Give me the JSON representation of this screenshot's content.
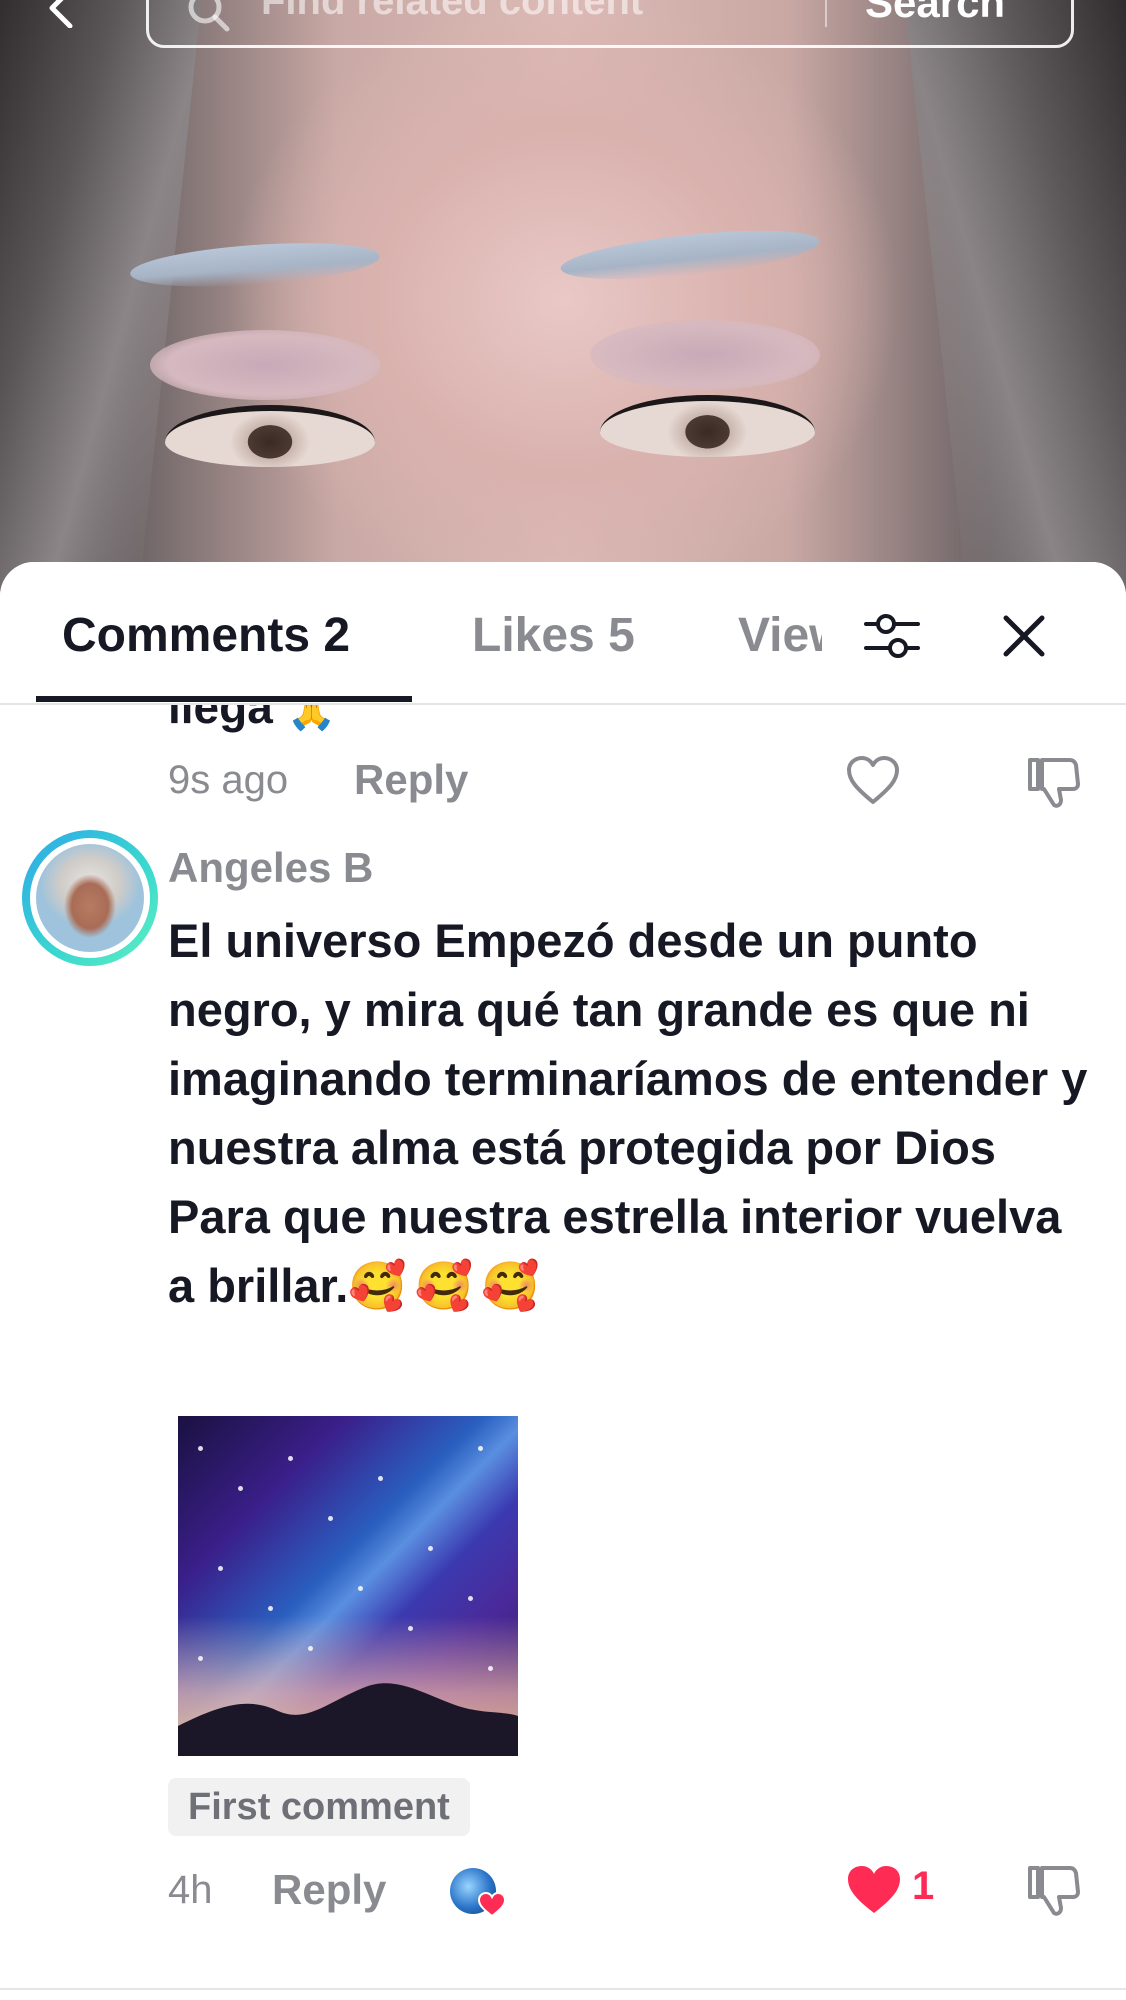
{
  "search": {
    "placeholder": "Find related content",
    "button": "Search"
  },
  "tabs": {
    "comments": "Comments 2",
    "likes": "Likes 5",
    "views": "Views"
  },
  "previous_comment": {
    "text_fragment": "llega",
    "emoji": "🙏",
    "time": "9s ago",
    "reply": "Reply"
  },
  "comment": {
    "author": "Angeles B",
    "text": "El universo Empezó desde un punto negro, y mira qué tan grande es que ni imaginando terminaríamos de entender y nuestra alma está protegida por Dios Para que nuestra estrella interior vuelva a brillar.",
    "emojis": "🥰🥰🥰",
    "badge": "First comment",
    "time": "4h",
    "reply": "Reply",
    "like_count": "1"
  },
  "colors": {
    "primary_text": "#161823",
    "secondary_text": "#8a8b91",
    "like_red": "#fe2c55"
  },
  "icons": [
    "back-arrow-icon",
    "search-icon",
    "filter-icon",
    "close-icon",
    "heart-outline-icon",
    "dislike-icon",
    "heart-filled-icon"
  ]
}
